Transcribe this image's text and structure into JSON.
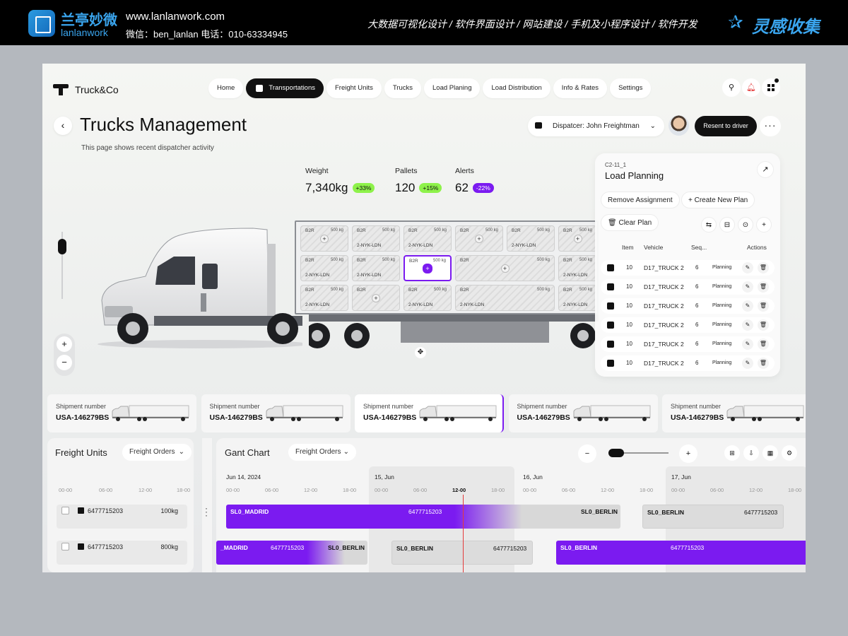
{
  "banner": {
    "brand_cn": "兰亭妙微",
    "brand_en": "lanlanwork",
    "url": "www.lanlanwork.com",
    "contact": "微信：ben_lanlan    电话：010-63334945",
    "services": "大数据可视化设计  /  软件界面设计  /  网站建设  /  手机及小程序设计  /  软件开发",
    "collect_label": "灵感收集"
  },
  "app": {
    "name": "Truck&Co",
    "nav": [
      "Home",
      "Transportations",
      "Freight Units",
      "Trucks",
      "Load Planing",
      "Load Distribution",
      "Info & Rates",
      "Settings"
    ],
    "active_nav": "Transportations",
    "page_title": "Trucks Management",
    "page_subtitle": "This page shows recent dispatcher activity",
    "dispatcher": "Dispatcer: John Freightman",
    "resend_label": "Resent to driver"
  },
  "stats": [
    {
      "label": "Weight",
      "value": "7,340kg",
      "delta": "+33%"
    },
    {
      "label": "Pallets",
      "value": "120",
      "delta": "+15%"
    },
    {
      "label": "Alerts",
      "value": "62",
      "delta": "-22%"
    }
  ],
  "trailer": {
    "slots": [
      {
        "type": "B2R",
        "weight": "500 kg",
        "route": "",
        "plus": true
      },
      {
        "type": "B2R",
        "weight": "500 kg",
        "route": "2-NYK-LDN",
        "plus": false
      },
      {
        "type": "B2R",
        "weight": "500 kg",
        "route": "2-NYK-LDN",
        "plus": false
      },
      {
        "type": "B2R",
        "weight": "500 kg",
        "route": "",
        "plus": true
      },
      {
        "type": "B2R",
        "weight": "500 kg",
        "route": "2-NYK-LDN",
        "plus": false
      },
      {
        "type": "B2R",
        "weight": "500 kg",
        "route": "",
        "plus": true
      },
      {
        "type": "B2R",
        "weight": "500 kg",
        "route": "2-NYK-LDN",
        "plus": false
      },
      {
        "type": "B2R",
        "weight": "500 kg",
        "route": "2-NYK-LDN",
        "plus": false
      },
      {
        "type": "B2R",
        "weight": "500 kg",
        "route": "",
        "plus": true,
        "selected": true
      },
      {
        "type": "B2R",
        "weight": "500 kg",
        "route": "",
        "plus": true
      },
      {
        "type": "B2R",
        "weight": "500 kg",
        "route": "2-NYK-LDN",
        "plus": false
      },
      {
        "type": "B2R",
        "weight": "500 kg",
        "route": "2-NYK-LDN",
        "plus": false
      },
      {
        "type": "B2R",
        "weight": "",
        "route": "",
        "plus": true
      },
      {
        "type": "B2R",
        "weight": "500 kg",
        "route": "2-NYK-LDN",
        "plus": false
      },
      {
        "type": "B2R",
        "weight": "500 kg",
        "route": "2-NYK-LDN",
        "plus": false
      },
      {
        "type": "B2R",
        "weight": "500 kg",
        "route": "2-NYK-LDN",
        "plus": false
      }
    ]
  },
  "load_planning": {
    "code": "C2-11_1",
    "title": "Load Planning",
    "remove_label": "Remove Assignment",
    "create_label": "Create New Plan",
    "clear_label": "Clear Plan",
    "headers": [
      "Item",
      "Vehicle",
      "Seq...",
      "Actions"
    ],
    "rows": [
      {
        "item": "10",
        "vehicle": "D17_TRUCK 2",
        "seq": "6",
        "status": "Planning"
      },
      {
        "item": "10",
        "vehicle": "D17_TRUCK 2",
        "seq": "6",
        "status": "Planning"
      },
      {
        "item": "10",
        "vehicle": "D17_TRUCK 2",
        "seq": "6",
        "status": "Planning"
      },
      {
        "item": "10",
        "vehicle": "D17_TRUCK 2",
        "seq": "6",
        "status": "Planning"
      },
      {
        "item": "10",
        "vehicle": "D17_TRUCK 2",
        "seq": "6",
        "status": "Planning"
      },
      {
        "item": "10",
        "vehicle": "D17_TRUCK 2",
        "seq": "6",
        "status": "Planning"
      }
    ]
  },
  "shipments": [
    {
      "label": "Shipment number",
      "number": "USA-146279BS"
    },
    {
      "label": "Shipment number",
      "number": "USA-146279BS"
    },
    {
      "label": "Shipment number",
      "number": "USA-146279BS",
      "active": true
    },
    {
      "label": "Shipment number",
      "number": "USA-146279BS"
    },
    {
      "label": "Shipment number",
      "number": "USA-146279BS"
    }
  ],
  "freight_units": {
    "title": "Freight Units",
    "dropdown": "Freight Orders",
    "hours": [
      "00-00",
      "06-00",
      "12-00",
      "18-00"
    ],
    "rows": [
      {
        "id": "6477715203",
        "weight": "100kg"
      },
      {
        "id": "6477715203",
        "weight": "800kg"
      }
    ]
  },
  "gantt": {
    "title": "Gant Chart",
    "dropdown": "Freight Orders",
    "days": [
      "Jun 14, 2024",
      "15, Jun",
      "16, Jun",
      "17, Jun"
    ],
    "hours": [
      "00-00",
      "06-00",
      "12-00",
      "18-00"
    ],
    "bars": [
      {
        "from": "SL0_MADRID",
        "id": "6477715203",
        "to": "SL0_BERLIN"
      },
      {
        "from": "SL0_BERLIN",
        "id": "6477715203",
        "to": ""
      },
      {
        "from": "_MADRID",
        "id": "6477715203",
        "to": "SL0_BERLIN"
      },
      {
        "from": "SL0_BERLIN",
        "id": "6477715203",
        "to": ""
      },
      {
        "from": "SL0_BERLIN",
        "id": "6477715203",
        "to": ""
      }
    ]
  },
  "colors": {
    "accent": "#7b1bf0",
    "lime": "#8ef24a",
    "dark": "#111111"
  }
}
